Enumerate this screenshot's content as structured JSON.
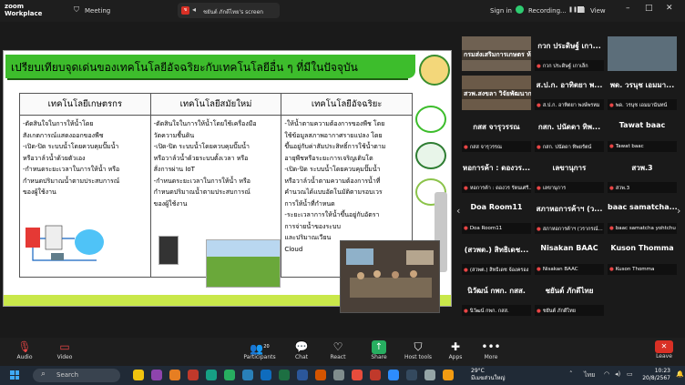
{
  "app": {
    "logo_line1": "zoom",
    "logo_line2": "Workplace"
  },
  "topbar": {
    "meeting_label": "Meeting",
    "share_label": "ชยันต์ ภักดีไทย's screen",
    "signin": "Sign in",
    "recording": "Recording...",
    "view": "View"
  },
  "slide": {
    "title": "เปรียบเทียบจุดเด่นของเทคโนโลยีอัจฉริยะกับเทคโนโลยีอื่น ๆ ที่มีในปัจจุบัน",
    "columns": [
      {
        "header": "เทคโนโลยีเกษตรกร",
        "body": "-ตัดสินใจในการให้น้ำโดย\nสังเกตการณ์แสดงออกของพืช\n-เปิด-ปิด ระบบน้ำโดยควบคุมปั๊มน้ำ\nหรือวาล์วน้ำด้วยตัวเอง\n-กำหนดระยะเวลาในการให้น้ำ หรือ\nกำหนดปริมาณน้ำตามประสบการณ์\nของผู้ใช้งาน"
      },
      {
        "header": "เทคโนโลยีสมัยใหม่",
        "body": "-ตัดสินใจในการให้น้ำโดยใช้เครื่องมือ\nวัดความชื้นดิน\n-เปิด-ปิด ระบบน้ำโดยควบคุมปั๊มน้ำ\nหรือวาล์วน้ำด้วยระบบตั้งเวลา หรือ\nสั่งการผ่าน IoT\n-กำหนดระยะเวลาในการให้น้ำ หรือ\nกำหนดปริมาณน้ำตามประสบการณ์\nของผู้ใช้งาน"
      },
      {
        "header": "เทคโนโลยีอัจฉริยะ",
        "body": "-ให้น้ำตามความต้องการของพืช โดย\nใช้ข้อมูลสภาพอากาศรายแปลง โดย\nขึ้นอยู่กับค่าสัมประสิทธิ์การใช้น้ำตาม\nอายุพืชหรือระยะการเจริญเติบโต\n-เปิด-ปิด ระบบน้ำโดยควบคุมปั๊มน้ำ\nหรือวาล์วน้ำตามความต้องการน้ำที่\nคำนวณได้แบบอัตโนมัติตามรอบเวร\nการให้น้ำที่กำหนด\n-ระยะเวลาการให้น้ำขึ้นอยู่กับอัตรา\nการจ่ายน้ำของระบบ\nและปริมาณเวียน\nCloud"
      }
    ]
  },
  "gallery": {
    "tiles": [
      {
        "type": "video",
        "name": "กรมส่งเสริมการเกษตร ห้องประชุม",
        "label": ""
      },
      {
        "type": "plain",
        "name": "กวก ประดิษฐ์ เกา...",
        "label": "กวก ประดิษฐ์ เกาเล็ก"
      },
      {
        "type": "video",
        "name": "",
        "label": ""
      },
      {
        "type": "video",
        "name": "สวพ.สงขลา วิจัยพัฒนาการ...",
        "label": ""
      },
      {
        "type": "plain",
        "name": "ส.ป.ก. อาทิตยา พ...",
        "label": "ส.ป.ก. อาทิตยา พงษ์พรหม"
      },
      {
        "type": "plain",
        "name": "พด. วรนุช เอมมา...",
        "label": "พด. วรนุช เอมมานันทน์"
      },
      {
        "type": "plain",
        "name": "กสส จารุวรรณ",
        "label": "กสส จารุวรรณ"
      },
      {
        "type": "plain",
        "name": "กสก. ปนัดดา ทิพ...",
        "label": "กสก. ปนัดดา ทิพยรัตน์"
      },
      {
        "type": "plain",
        "name": "Tawat baac",
        "label": "Tawat baac"
      },
      {
        "type": "plain",
        "name": "หอการค้า : ดองวร...",
        "label": "หอการค้า : ดองวร รัตนเศรี..."
      },
      {
        "type": "plain",
        "name": "เลขานุการ",
        "label": "เลขานุการ"
      },
      {
        "type": "plain",
        "name": "สวพ.3",
        "label": "สวพ.3"
      },
      {
        "type": "plain",
        "name": "Doa Room11",
        "label": "Doa Room11"
      },
      {
        "type": "plain",
        "name": "สภาหอการค้าฯ (ว...",
        "label": "สภาหอการค้าฯ (วรากรณ์..."
      },
      {
        "type": "plain",
        "name": "baac samatcha...",
        "label": "baac samatcha yohtchu"
      },
      {
        "type": "plain",
        "name": "(สวพต.) สิทธิเดช...",
        "label": "(สวพต.) สิทธิเดช จ้องครอง"
      },
      {
        "type": "plain",
        "name": "Nisakan BAAC",
        "label": "Nisakan BAAC"
      },
      {
        "type": "plain",
        "name": "Kuson Thomma",
        "label": "Kuson Thomma"
      },
      {
        "type": "plain",
        "name": "นิวัฒน์ กพก. กสส.",
        "label": "นิวัฒน์ กพก. กสส."
      },
      {
        "type": "plain",
        "name": "ชยันต์ ภักดีไทย",
        "label": "ชยันต์ ภักดีไทย"
      }
    ]
  },
  "toolbar": {
    "audio": "Audio",
    "video": "Video",
    "participants": "Participants",
    "participants_count": "20",
    "chat": "Chat",
    "react": "React",
    "share": "Share",
    "host_tools": "Host tools",
    "apps": "Apps",
    "more": "More",
    "leave": "Leave"
  },
  "taskbar": {
    "search_placeholder": "Search",
    "temp": "29°C",
    "weather": "มีเมฆส่วนใหญ่",
    "lang": "ไทย",
    "time": "10:23",
    "date": "20/8/2567"
  }
}
